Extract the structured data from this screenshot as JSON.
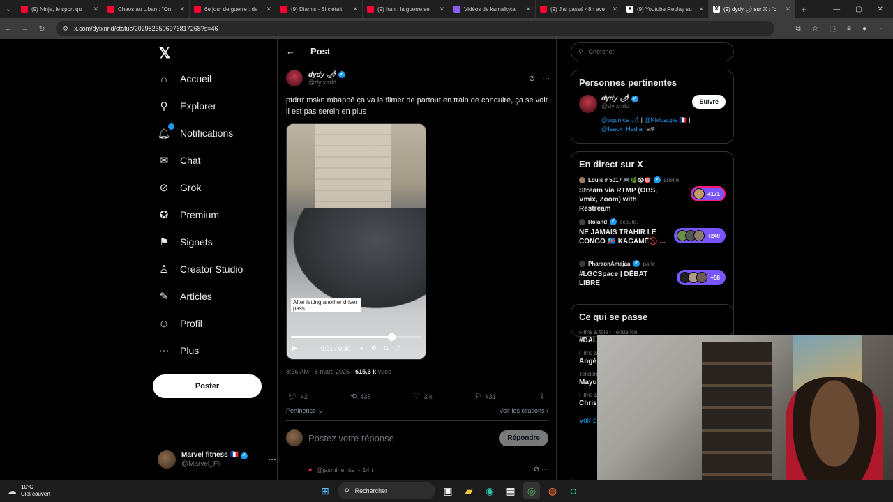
{
  "browser": {
    "tabs": [
      {
        "label": "(9) Ninja, le sport qu",
        "icon": "youtube-icon",
        "active": false
      },
      {
        "label": "Chaos au Liban : \"On",
        "icon": "youtube-icon",
        "active": false
      },
      {
        "label": "6e jour de guerre : de",
        "icon": "youtube-icon",
        "active": false
      },
      {
        "label": "(9) Diam's - Si c'était",
        "icon": "youtube-icon",
        "active": false
      },
      {
        "label": "(9) Iran : la guerre se",
        "icon": "youtube-icon",
        "active": false
      },
      {
        "label": "Vidéos de kamalkyta",
        "icon": "twitch-icon",
        "active": false
      },
      {
        "label": "(9) J'ai passé 48h ave",
        "icon": "youtube-icon",
        "active": false
      },
      {
        "label": "(9) Youtube Replay su",
        "icon": "x-icon",
        "active": false
      },
      {
        "label": "(9) dydy 🌶 sur X : \"p",
        "icon": "x-icon",
        "active": true
      }
    ],
    "url": "x.com/dylxnrld/status/2029823506976817268?s=46"
  },
  "nav": {
    "items": [
      {
        "label": "Accueil",
        "icon": "home-icon"
      },
      {
        "label": "Explorer",
        "icon": "search-icon"
      },
      {
        "label": "Notifications",
        "icon": "bell-icon"
      },
      {
        "label": "Chat",
        "icon": "mail-icon"
      },
      {
        "label": "Grok",
        "icon": "grok-icon"
      },
      {
        "label": "Premium",
        "icon": "premium-icon"
      },
      {
        "label": "Signets",
        "icon": "bookmark-icon"
      },
      {
        "label": "Creator Studio",
        "icon": "creator-icon"
      },
      {
        "label": "Articles",
        "icon": "articles-icon"
      },
      {
        "label": "Profil",
        "icon": "profile-icon"
      },
      {
        "label": "Plus",
        "icon": "more-icon"
      }
    ],
    "post_button": "Poster",
    "account": {
      "name": "Marvel fitness 🇫🇷",
      "handle": "@Marvel_Flt"
    }
  },
  "main": {
    "header": "Post",
    "author": {
      "name": "dydy 🌶",
      "handle": "@dylxnrld"
    },
    "text": "ptdrrr mskn mbappé ça va le filmer de partout en train de conduire, ça se voit il est pas serein en plus",
    "video": {
      "caption": "After letting another driver pass...",
      "time": "0:31 / 0:40",
      "progress": 0.775
    },
    "meta": {
      "time": "8:36 AM · 6 mars 2026 ·",
      "views": "615,3 k",
      "views_label": "vues"
    },
    "stats": {
      "replies": "42",
      "reposts": "438",
      "likes": "3 k",
      "bookmarks": "431"
    },
    "sort": "Pertinence",
    "quotes_link": "Voir les citations",
    "reply_placeholder": "Postez votre réponse",
    "reply_button": "Répondre",
    "next_reply": {
      "handle": "@jasminemts",
      "time": "· 14h"
    }
  },
  "right": {
    "search_placeholder": "Chercher",
    "relevant": {
      "title": "Personnes pertinentes",
      "name": "dydy 🌶",
      "handle": "@dylxnrld",
      "follow": "Suivre",
      "bio_1a": "@ogcnice 🌶",
      "bio_1b": " | ",
      "bio_1c": "@KMbappe",
      "bio_1d": " 🇫🇷 |",
      "bio_2a": "@Isack_Hadjar",
      "bio_2b": " 🏎"
    },
    "live": {
      "title": "En direct sur X",
      "items": [
        {
          "host": "Louis # 5017 🎮🌿👁🎯",
          "role": "anime.",
          "title": "Stream via RTMP (OBS, Vmix, Zoom) with Restream",
          "count": "+171"
        },
        {
          "host": "Roland",
          "role": "écoute.",
          "title": "NE JAMAIS TRAHIR LE CONGO 🇨🇩 KAGAMÉ🚫 ...",
          "count": "+240"
        },
        {
          "host": "PharaonAmajaa",
          "role": "parle.",
          "title": "#LGCSpace | DÉBAT LIBRE",
          "count": "+58"
        }
      ]
    },
    "trends": {
      "title": "Ce qui se passe",
      "items": [
        {
          "cat": "Films & télé · Tendance",
          "name": "#DAL"
        },
        {
          "cat": "Films &",
          "name": "Angé"
        },
        {
          "cat": "Tendan",
          "name": "Mayu"
        },
        {
          "cat": "Films &",
          "name": "Chris"
        }
      ],
      "voir": "Voir p"
    }
  },
  "taskbar": {
    "temp": "10°C",
    "weather": "Ciel couvert",
    "search": "Rechercher"
  },
  "colors": {
    "accent": "#1d9bf0",
    "live": "#7856ff",
    "bg": "#000000",
    "border": "#2f3336"
  }
}
